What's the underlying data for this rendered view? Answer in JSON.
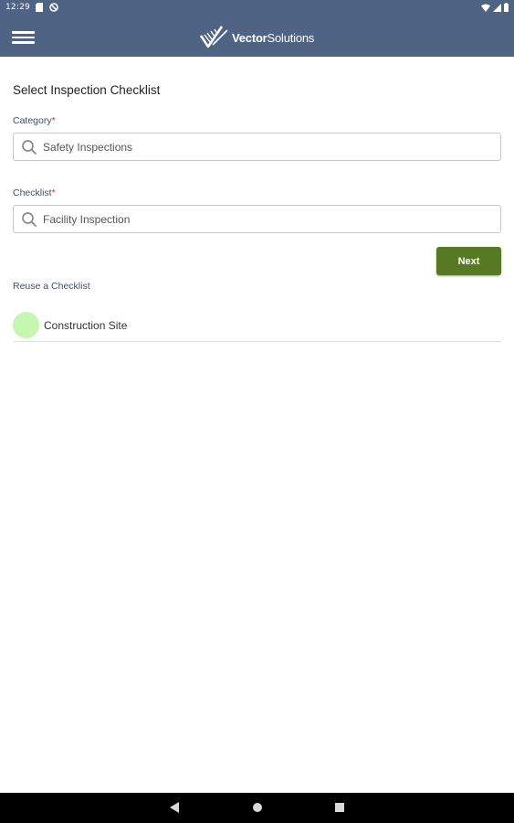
{
  "status_bar": {
    "time": "12:29"
  },
  "header": {
    "menu_icon": "hamburger-menu-icon",
    "brand_bold": "Vector",
    "brand_light": "Solutions",
    "background": "#4f6385"
  },
  "main": {
    "title": "Select Inspection Checklist",
    "category": {
      "label": "Category",
      "required_mark": "*",
      "value": "Safety Inspections"
    },
    "checklist": {
      "label": "Checklist",
      "required_mark": "*",
      "value": "Facility Inspection"
    },
    "next_label": "Next",
    "next_color": "#567a24",
    "reuse": {
      "label": "Reuse a Checklist",
      "items": [
        {
          "label": "Construction Site",
          "dot_color": "#c6f7b0"
        }
      ]
    }
  },
  "nav_bar": {
    "back_icon": "back-triangle-icon",
    "home_icon": "home-circle-icon",
    "recents_icon": "recents-square-icon"
  }
}
